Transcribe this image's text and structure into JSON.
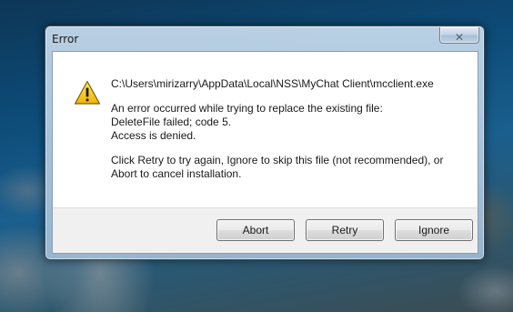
{
  "window": {
    "title": "Error",
    "close_icon": "close-icon",
    "close_glyph": "✕"
  },
  "message": {
    "icon": "warning-icon",
    "path": "C:\\Users\\mirizarry\\AppData\\Local\\NSS\\MyChat Client\\mcclient.exe",
    "error_lines": [
      "An error occurred while trying to replace the existing file:",
      "DeleteFile failed; code 5.",
      "Access is denied."
    ],
    "instruction_lines": [
      "Click Retry to try again, Ignore to skip this file (not recommended), or",
      "Abort to cancel installation."
    ]
  },
  "buttons": {
    "abort": "Abort",
    "retry": "Retry",
    "ignore": "Ignore"
  },
  "colors": {
    "warning_fill": "#f7c51a",
    "warning_border": "#6b5400"
  }
}
